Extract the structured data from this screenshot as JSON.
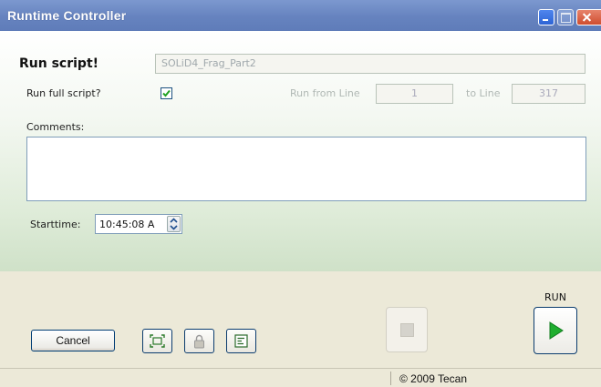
{
  "window": {
    "title": "Runtime Controller"
  },
  "form": {
    "run_script_label": "Run script!",
    "script_name": "SOLiD4_Frag_Part2",
    "run_full_label": "Run full script?",
    "run_full_checked": true,
    "run_from_label": "Run from Line",
    "run_from_value": "1",
    "to_line_label": "to Line",
    "to_line_value": "317",
    "comments_label": "Comments:",
    "comments_value": "",
    "starttime_label": "Starttime:",
    "starttime_value": "10:45:08 A"
  },
  "buttons": {
    "cancel": "Cancel",
    "run": "RUN"
  },
  "icons": {
    "tool1": "fit-screen-icon",
    "tool2": "lock-icon",
    "tool3": "list-icon",
    "stop": "stop-icon",
    "run": "play-icon"
  },
  "colors": {
    "titlebar": "#6a86c2",
    "run_green": "#1fae2f",
    "panel": "#dfecd9"
  },
  "status": {
    "copyright": "© 2009 Tecan"
  }
}
